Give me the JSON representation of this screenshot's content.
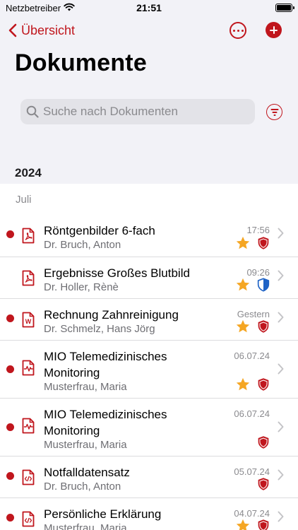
{
  "status_bar": {
    "carrier": "Netzbetreiber",
    "time": "21:51"
  },
  "nav": {
    "back_label": "Übersicht"
  },
  "title": "Dokumente",
  "search": {
    "placeholder": "Suche nach Dokumenten"
  },
  "year": "2024",
  "month": "Juli",
  "colors": {
    "accent": "#c0161d",
    "star": "#f5a623",
    "shield_blue": "#1f63c6"
  },
  "documents": [
    {
      "title": "Röntgenbilder 6-fach",
      "person": "Dr. Bruch, Anton",
      "time": "17:56",
      "file_icon": "pdf-file-icon",
      "unread": true,
      "starred": true,
      "shield": "red-shield-icon"
    },
    {
      "title": "Ergebnisse Großes Blutbild",
      "person": "Dr. Holler, Rènè",
      "time": "09:26",
      "file_icon": "pdf-file-icon",
      "unread": false,
      "starred": true,
      "shield": "blue-shield-icon"
    },
    {
      "title": "Rechnung Zahnreinigung",
      "person": "Dr. Schmelz, Hans Jörg",
      "time": "Gestern",
      "file_icon": "word-file-icon",
      "unread": true,
      "starred": true,
      "shield": "red-shield-icon"
    },
    {
      "title": "MIO Telemedizinisches Monitoring",
      "person": "Musterfrau, Maria",
      "time": "06.07.24",
      "file_icon": "pulse-file-icon",
      "unread": true,
      "starred": true,
      "shield": "red-shield-icon"
    },
    {
      "title": "MIO Telemedizinisches Monitoring",
      "person": "Musterfrau, Maria",
      "time": "06.07.24",
      "file_icon": "pulse-file-icon",
      "unread": true,
      "starred": false,
      "shield": "red-shield-icon"
    },
    {
      "title": "Notfalldatensatz",
      "person": "Dr. Bruch, Anton",
      "time": "05.07.24",
      "file_icon": "code-file-icon",
      "unread": true,
      "starred": false,
      "shield": "red-shield-icon"
    },
    {
      "title": "Persönliche Erklärung",
      "person": "Musterfrau, Maria",
      "time": "04.07.24",
      "file_icon": "code-file-icon",
      "unread": true,
      "starred": true,
      "shield": "red-shield-icon"
    }
  ]
}
